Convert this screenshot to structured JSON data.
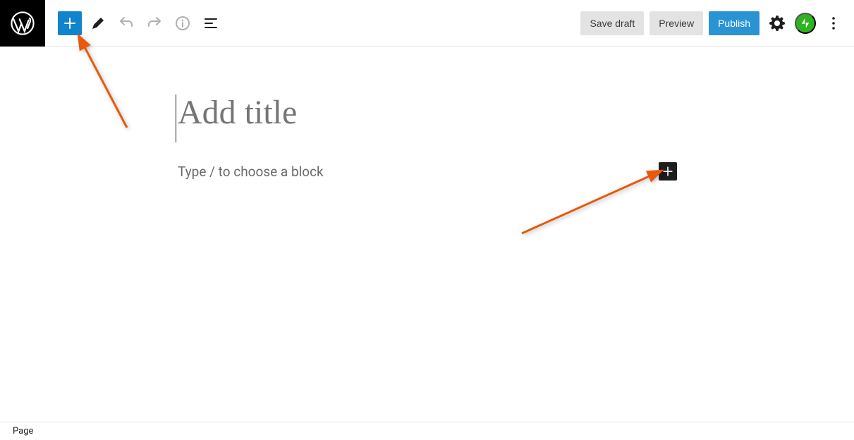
{
  "toolbar": {
    "save_draft_label": "Save draft",
    "preview_label": "Preview",
    "publish_label": "Publish"
  },
  "editor": {
    "title_placeholder": "Add title",
    "block_placeholder": "Type / to choose a block"
  },
  "breadcrumb": {
    "current": "Page"
  },
  "icons": {
    "wp_logo": "wordpress-logo",
    "add_block": "plus-icon",
    "edit_tool": "pencil-icon",
    "undo": "undo-icon",
    "redo": "redo-icon",
    "info": "info-icon",
    "outline": "outline-icon",
    "settings": "gear-icon",
    "jetpack": "jetpack-icon",
    "more": "dots-vertical-icon",
    "inline_add": "plus-icon"
  },
  "colors": {
    "accent_blue": "#1084cc",
    "publish_blue": "#2993d4",
    "jetpack_green": "#2fb41f",
    "arrow_orange": "#e8590c"
  }
}
